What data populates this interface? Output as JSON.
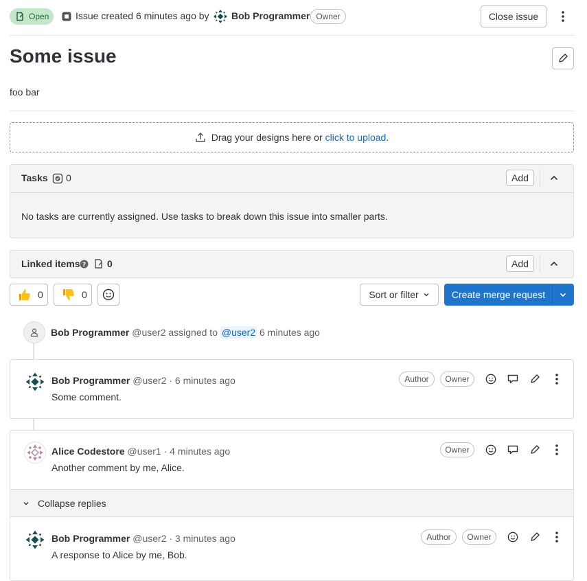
{
  "header": {
    "status_badge": "Open",
    "created_text": "Issue created 6 minutes ago by",
    "author_name": "Bob Programmer",
    "author_badge": "Owner",
    "close_button": "Close issue"
  },
  "issue": {
    "title": "Some issue",
    "description": "foo bar"
  },
  "design_upload": {
    "text": "Drag your designs here or",
    "link": "click to upload",
    "suffix": "."
  },
  "tasks": {
    "title": "Tasks",
    "count": "0",
    "add_label": "Add",
    "empty_text": "No tasks are currently assigned. Use tasks to break down this issue into smaller parts."
  },
  "linked_items": {
    "title": "Linked items",
    "count": "0",
    "add_label": "Add"
  },
  "reactions": {
    "thumbs_up_count": "0",
    "thumbs_down_count": "0"
  },
  "controls": {
    "sort_filter": "Sort or filter",
    "create_mr": "Create merge request"
  },
  "activity": {
    "system_note": {
      "author": "Bob Programmer",
      "handle": "@user2",
      "action": "assigned to",
      "mention": "@user2",
      "time": "6 minutes ago"
    },
    "comments": [
      {
        "author": "Bob Programmer",
        "handle": "@user2",
        "time": "· 6 minutes ago",
        "badges": [
          "Author",
          "Owner"
        ],
        "text": "Some comment."
      },
      {
        "author": "Alice Codestore",
        "handle": "@user1",
        "time": "· 4 minutes ago",
        "badges": [
          "Owner"
        ],
        "text": "Another comment by me, Alice.",
        "collapse_label": "Collapse replies",
        "reply": {
          "author": "Bob Programmer",
          "handle": "@user2",
          "time": "· 3 minutes ago",
          "badges": [
            "Author",
            "Owner"
          ],
          "text": "A response to Alice by me, Bob."
        }
      }
    ]
  },
  "colors": {
    "accent_blue": "#1f75cb",
    "open_green_bg": "#c3e6cd",
    "open_green_text": "#24663b",
    "link_blue": "#1068bf"
  },
  "icons": [
    "issue-open-icon",
    "issue-type-icon",
    "pencil-icon",
    "upload-icon",
    "task-done-icon",
    "chevron-up-icon",
    "question-icon",
    "linked-issue-icon",
    "thumbs-up-icon",
    "thumbs-down-icon",
    "smile-icon",
    "chevron-down-icon",
    "user-icon",
    "reply-icon",
    "kebab-icon"
  ]
}
